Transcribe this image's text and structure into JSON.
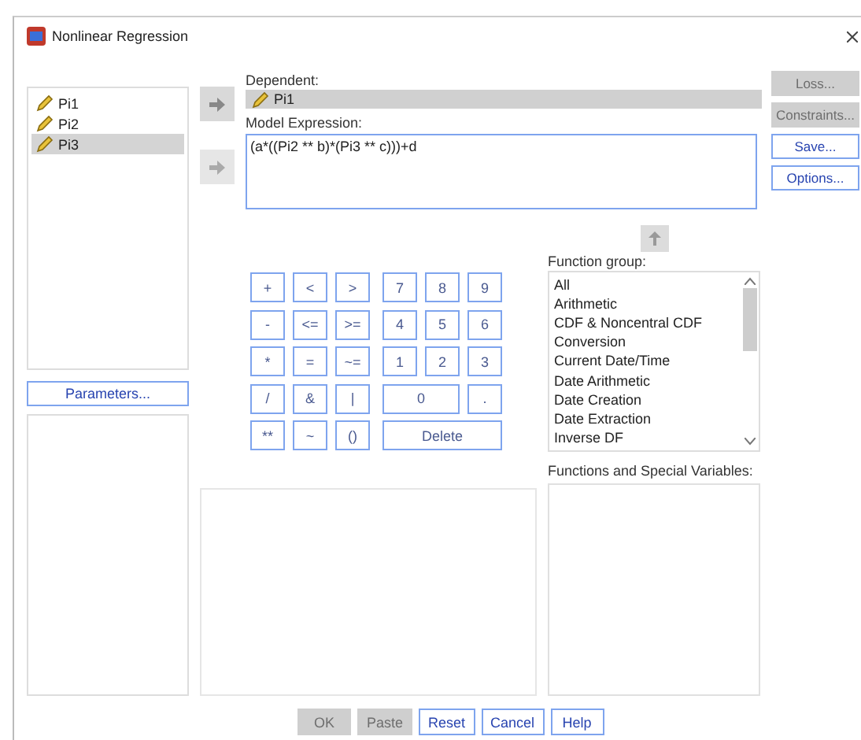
{
  "window": {
    "title": "Nonlinear Regression"
  },
  "variables": [
    {
      "name": "Pi1",
      "selected": false
    },
    {
      "name": "Pi2",
      "selected": false
    },
    {
      "name": "Pi3",
      "selected": true
    }
  ],
  "parameters_button": "Parameters...",
  "dependent": {
    "label": "Dependent:",
    "value": "Pi1"
  },
  "model_expression": {
    "label": "Model Expression:",
    "value": "(a*((Pi2 ** b)*(Pi3 ** c)))+d"
  },
  "side_buttons": [
    {
      "label": "Loss...",
      "disabled": true
    },
    {
      "label": "Constraints...",
      "disabled": true
    },
    {
      "label": "Save...",
      "disabled": false
    },
    {
      "label": "Options...",
      "disabled": false
    }
  ],
  "keypad": [
    [
      "+",
      "<",
      ">",
      "7",
      "8",
      "9"
    ],
    [
      "-",
      "<=",
      ">=",
      "4",
      "5",
      "6"
    ],
    [
      "*",
      "=",
      "~=",
      "1",
      "2",
      "3"
    ],
    [
      "/",
      "&",
      "|",
      "0",
      "."
    ],
    [
      "**",
      "~",
      "()",
      "Delete"
    ]
  ],
  "function_group": {
    "label": "Function group:",
    "items": [
      "All",
      "Arithmetic",
      "CDF & Noncentral CDF",
      "Conversion",
      "Current Date/Time",
      "Date Arithmetic",
      "Date Creation",
      "Date Extraction",
      "Inverse DF"
    ]
  },
  "functions": {
    "label": "Functions and Special Variables:"
  },
  "footer_buttons": [
    {
      "label": "OK",
      "disabled": true
    },
    {
      "label": "Paste",
      "disabled": true
    },
    {
      "label": "Reset",
      "disabled": false
    },
    {
      "label": "Cancel",
      "disabled": false
    },
    {
      "label": "Help",
      "disabled": false
    }
  ]
}
